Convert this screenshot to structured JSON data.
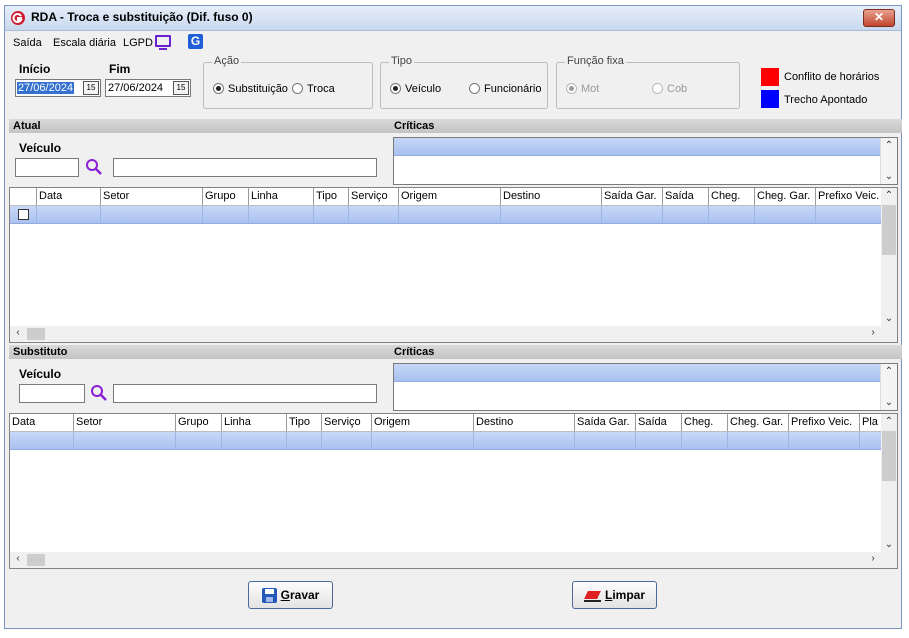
{
  "window": {
    "title": "RDA - Troca e substituição (Dif. fuso 0)",
    "close_label": "✕"
  },
  "menu": [
    "Saída",
    "Escala diária",
    "LGPD"
  ],
  "dates": {
    "inicio_label": "Início",
    "inicio_value": "27/06/2024",
    "fim_label": "Fim",
    "fim_value": "27/06/2024",
    "calendar_glyph": "15"
  },
  "acao": {
    "title": "Ação",
    "options": [
      "Substituição",
      "Troca"
    ],
    "selected": "Substituição"
  },
  "tipo": {
    "title": "Tipo",
    "options": [
      "Veículo",
      "Funcionário"
    ],
    "selected": "Veículo"
  },
  "funcao_fixa": {
    "title": "Função fixa",
    "options": [
      "Mot",
      "Cob"
    ],
    "selected": "Mot"
  },
  "legend": [
    {
      "label": "Conflito de horários",
      "color": "#ff0000"
    },
    {
      "label": "Trecho Apontado",
      "color": "#0000ff"
    }
  ],
  "atual": {
    "section_label": "Atual",
    "criticas_label": "Críticas",
    "veiculo_label": "Veículo",
    "columns": [
      "",
      "Data",
      "Setor",
      "Grupo",
      "Linha",
      "Tipo",
      "Serviço",
      "Origem",
      "Destino",
      "Saída Gar.",
      "Saída",
      "Cheg.",
      "Cheg. Gar.",
      "Prefixo Veic."
    ]
  },
  "substituto": {
    "section_label": "Substituto",
    "criticas_label": "Críticas",
    "veiculo_label": "Veículo",
    "columns": [
      "Data",
      "Setor",
      "Grupo",
      "Linha",
      "Tipo",
      "Serviço",
      "Origem",
      "Destino",
      "Saída Gar.",
      "Saída",
      "Cheg.",
      "Cheg. Gar.",
      "Prefixo Veic.",
      "Pla"
    ]
  },
  "buttons": {
    "gravar_first": "G",
    "gravar_rest": "ravar",
    "limpar_first": "L",
    "limpar_rest": "impar"
  },
  "icons": {
    "app": "app-logo-icon",
    "lgpd": "monitor-icon",
    "g": "g-logo-icon",
    "search": "search-icon"
  },
  "colors": {
    "accent": "#3370d0",
    "selection": "#aac2f0"
  }
}
